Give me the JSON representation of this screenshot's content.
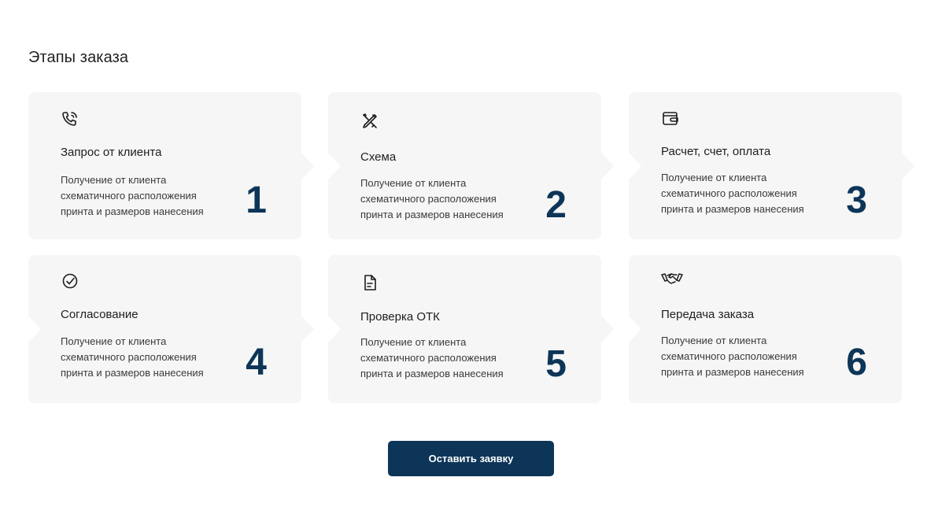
{
  "section": {
    "title": "Этапы заказа"
  },
  "steps": [
    {
      "number": "1",
      "title": "Запрос от клиента",
      "description": "Получение от клиента схематичного расположения принта и размеров нанесения",
      "icon": "phone-icon"
    },
    {
      "number": "2",
      "title": "Схема",
      "description": "Получение от клиента схематичного расположения принта и размеров нанесения",
      "icon": "pencil-ruler-icon"
    },
    {
      "number": "3",
      "title": "Расчет, счет, оплата",
      "description": "Получение от клиента схематичного расположения принта и размеров нанесения",
      "icon": "wallet-icon"
    },
    {
      "number": "4",
      "title": "Согласование",
      "description": "Получение от клиента схематичного расположения принта и размеров нанесения",
      "icon": "check-circle-icon"
    },
    {
      "number": "5",
      "title": "Проверка ОТК",
      "description": "Получение от клиента схематичного расположения принта и размеров нанесения",
      "icon": "document-icon"
    },
    {
      "number": "6",
      "title": "Передача заказа",
      "description": "Получение от клиента схематичного расположения принта и размеров нанесения",
      "icon": "handshake-icon"
    }
  ],
  "cta": {
    "label": "Оставить заявку"
  },
  "colors": {
    "accent": "#0d3558",
    "card_bg": "#f6f6f6"
  }
}
